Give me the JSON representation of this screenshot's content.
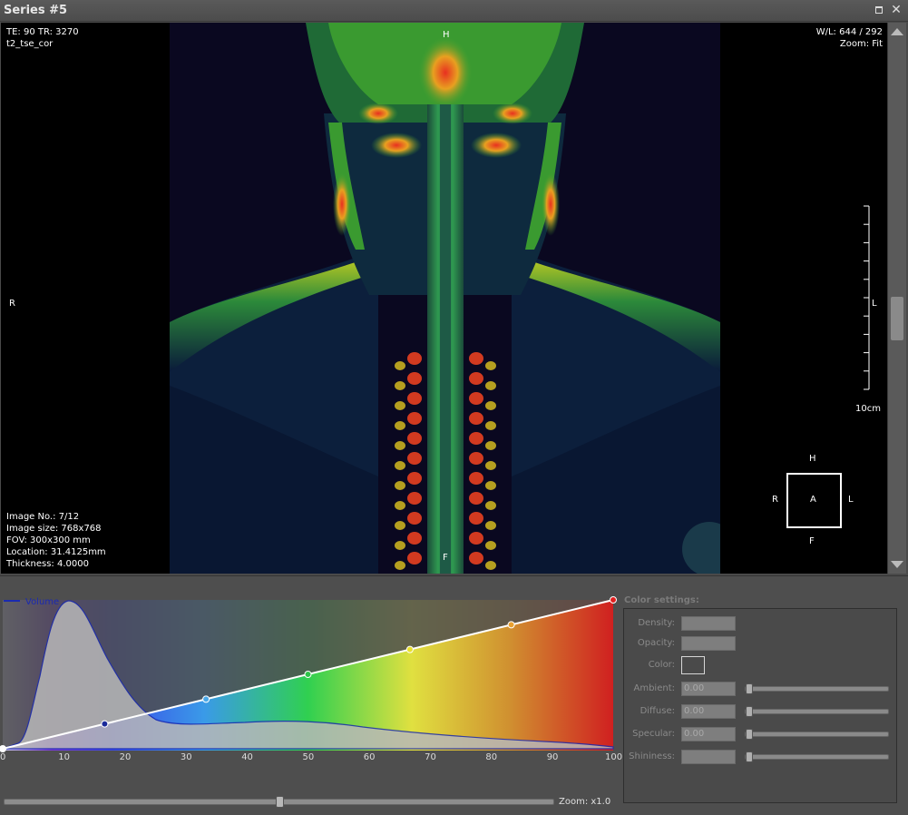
{
  "window": {
    "title": "Series #5"
  },
  "viewer": {
    "top_left": [
      "TE: 90   TR: 3270",
      "t2_tse_cor"
    ],
    "top_right": [
      "W/L: 644 / 292",
      "Zoom: Fit"
    ],
    "bottom_left": [
      "Image No.: 7/12",
      "Image size: 768x768",
      "FOV: 300x300 mm",
      "Location: 31.4125mm",
      "Thickness: 4.0000"
    ],
    "orient_top": "H",
    "orient_bottom": "F",
    "orient_left": "R",
    "orient_right": "L",
    "scale_label": "10cm",
    "cube": {
      "top": "H",
      "bottom": "F",
      "left": "R",
      "right": "L",
      "center": "A"
    }
  },
  "transfer_function": {
    "legend": "Volume",
    "x_ticks": [
      "0",
      "10",
      "20",
      "30",
      "40",
      "50",
      "60",
      "70",
      "80",
      "90",
      "100"
    ],
    "control_points": [
      {
        "x": 0,
        "color": "#ffffff"
      },
      {
        "x": 16.7,
        "color": "#1a2a9a"
      },
      {
        "x": 33.3,
        "color": "#4aa8e8"
      },
      {
        "x": 50,
        "color": "#2ec44a"
      },
      {
        "x": 66.7,
        "color": "#e8e030"
      },
      {
        "x": 83.3,
        "color": "#e8a030"
      },
      {
        "x": 100,
        "color": "#e02020"
      }
    ]
  },
  "zoom": {
    "label": "Zoom: x1.0",
    "value": 0.5
  },
  "color_settings": {
    "title": "Color settings:",
    "density_label": "Density:",
    "opacity_label": "Opacity:",
    "color_label": "Color:",
    "ambient_label": "Ambient:",
    "ambient_value": "0.00",
    "diffuse_label": "Diffuse:",
    "diffuse_value": "0.00",
    "specular_label": "Specular:",
    "specular_value": "0.00",
    "shininess_label": "Shininess:"
  },
  "colors": {
    "background": "#4a4a4a",
    "viewer_bg": "#000000",
    "accent": "#0000c8"
  }
}
